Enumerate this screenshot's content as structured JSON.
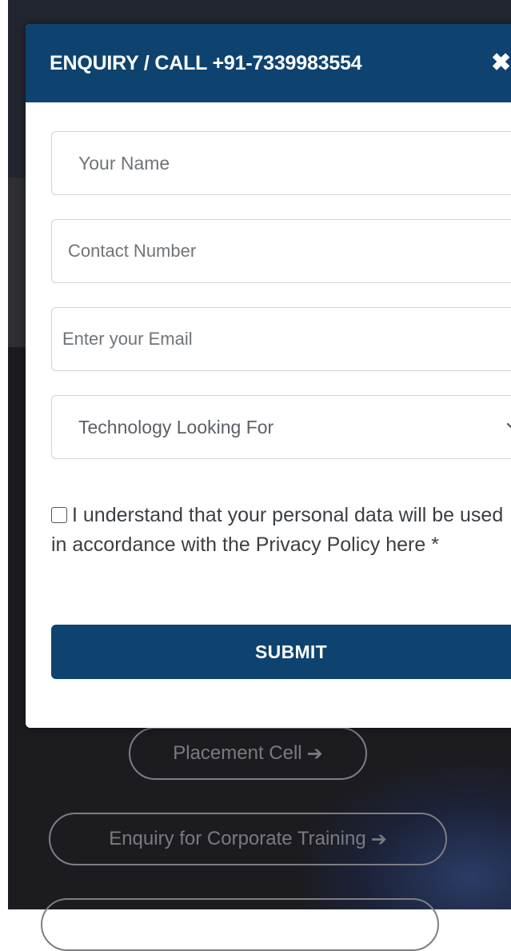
{
  "modal": {
    "title": "ENQUIRY / CALL +91-7339983554",
    "close_icon": "close-icon",
    "fields": {
      "name_placeholder": "Your Name",
      "contact_placeholder": "Contact Number",
      "email_placeholder": "Enter your Email",
      "technology_selected": "Technology Looking For"
    },
    "consent_text": "I understand that your personal data will be used in accordance with the Privacy Policy here *",
    "submit_label": "SUBMIT"
  },
  "background": {
    "links": [
      {
        "label": "Placement Cell"
      },
      {
        "label": "Enquiry for Corporate Training"
      },
      {
        "label": ""
      }
    ]
  },
  "colors": {
    "accent": "#0e4370",
    "overlay": "#1b1b1f"
  }
}
